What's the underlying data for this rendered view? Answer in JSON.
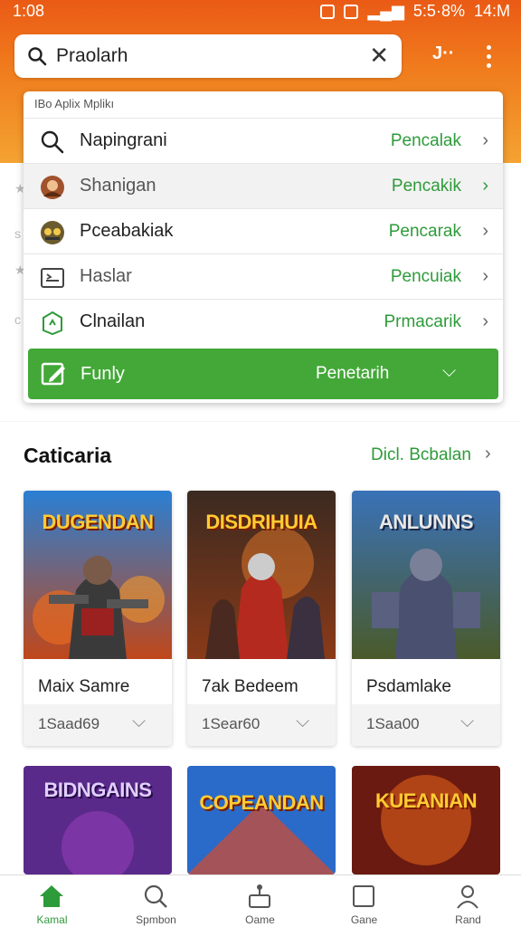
{
  "status_bar": {
    "time": "1:08",
    "right_text": "5:5·8%",
    "clock": "14:M"
  },
  "header": {
    "search_value": "Praolarh",
    "profile_label": "J··"
  },
  "dropdown": {
    "header": "IBo Aplix Mplikı",
    "items": [
      {
        "label": "Napingrani",
        "action": "Pencalak",
        "icon": "search-icon"
      },
      {
        "label": "Shanigan",
        "action": "Pencakik",
        "icon": "avatar-icon"
      },
      {
        "label": "Pceabakiak",
        "action": "Pencarak",
        "icon": "game-icon"
      },
      {
        "label": "Haslar",
        "action": "Pencuiak",
        "icon": "image-icon"
      },
      {
        "label": "Clnailan",
        "action": "Prmacarik",
        "icon": "tag-icon"
      }
    ],
    "highlight": {
      "label": "Funly",
      "action": "Penetarih",
      "icon": "edit-icon"
    }
  },
  "section": {
    "title": "Caticaria",
    "more": "Dicl. Bcbalan"
  },
  "cards": [
    {
      "title": "Maix Samre",
      "art_title": "DUGENDAN",
      "sub": "1Saad69"
    },
    {
      "title": "7ak Bedeem",
      "art_title": "DISDRIHUIA",
      "sub": "1Sear60"
    },
    {
      "title": "Psdamlake",
      "art_title": "ANLUNNS",
      "sub": "1Saa00"
    }
  ],
  "cards_row2": [
    {
      "art_title": "BIDNGAINS"
    },
    {
      "art_title": "COPEANDAN"
    },
    {
      "art_title": "KUEANIAN"
    }
  ],
  "bottom_nav": [
    {
      "label": "Kamal",
      "icon": "home-icon",
      "active": true
    },
    {
      "label": "Spmbon",
      "icon": "search-icon",
      "active": false
    },
    {
      "label": "Oame",
      "icon": "joystick-icon",
      "active": false
    },
    {
      "label": "Gane",
      "icon": "square-icon",
      "active": false
    },
    {
      "label": "Rand",
      "icon": "person-icon",
      "active": false
    }
  ],
  "colors": {
    "accent_green": "#2e9b3a",
    "header_orange": "#ea5a16"
  }
}
